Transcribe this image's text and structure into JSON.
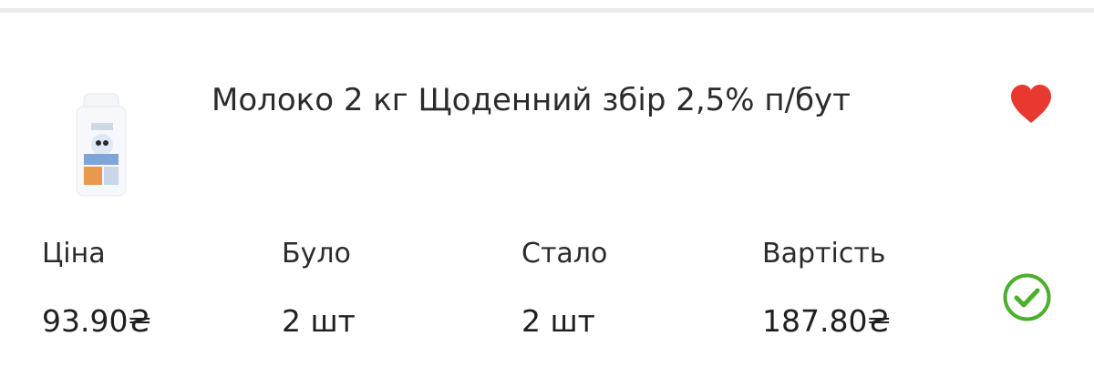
{
  "product": {
    "title": "Молоко 2 кг Щоденний збір 2,5% п/бут",
    "favorite": true
  },
  "columns": [
    {
      "label": "Ціна",
      "value": "93.90₴"
    },
    {
      "label": "Було",
      "value": "2 шт"
    },
    {
      "label": "Стало",
      "value": "2 шт"
    },
    {
      "label": "Вартість",
      "value": "187.80₴"
    }
  ],
  "icons": {
    "favorite": "heart-icon",
    "confirm": "check-circle-icon"
  },
  "colors": {
    "heart": "#e8382f",
    "check": "#4caf2e",
    "text": "#2b2b2b",
    "divider": "#ebebeb"
  }
}
